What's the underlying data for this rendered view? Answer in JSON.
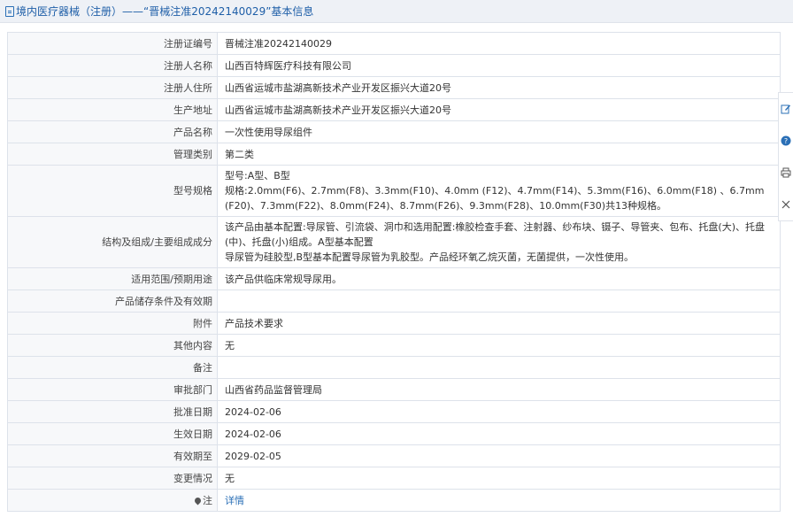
{
  "header": {
    "title": "境内医疗器械（注册）——“晋械注准20242140029”基本信息"
  },
  "rows": [
    {
      "label": "注册证编号",
      "lines": [
        "晋械注准20242140029"
      ]
    },
    {
      "label": "注册人名称",
      "lines": [
        "山西百特辉医疗科技有限公司"
      ]
    },
    {
      "label": "注册人住所",
      "lines": [
        "山西省运城市盐湖高新技术产业开发区振兴大道20号"
      ]
    },
    {
      "label": "生产地址",
      "lines": [
        "山西省运城市盐湖高新技术产业开发区振兴大道20号"
      ]
    },
    {
      "label": "产品名称",
      "lines": [
        "一次性使用导尿组件"
      ]
    },
    {
      "label": "管理类别",
      "lines": [
        "第二类"
      ]
    },
    {
      "label": "型号规格",
      "lines": [
        "型号:A型、B型",
        "规格:2.0mm(F6)、2.7mm(F8)、3.3mm(F10)、4.0mm (F12)、4.7mm(F14)、5.3mm(F16)、6.0mm(F18) 、6.7mm(F20)、7.3mm(F22)、8.0mm(F24)、8.7mm(F26)、9.3mm(F28)、10.0mm(F30)共13种规格。"
      ]
    },
    {
      "label": "结构及组成/主要组成成分",
      "lines": [
        "该产品由基本配置:导尿管、引流袋、洞巾和选用配置:橡胶检查手套、注射器、纱布块、镊子、导管夹、包布、托盘(大)、托盘(中)、托盘(小)组成。A型基本配置",
        "导尿管为硅胶型,B型基本配置导尿管为乳胶型。产品经环氧乙烷灭菌，无菌提供，一次性使用。"
      ]
    },
    {
      "label": "适用范围/预期用途",
      "lines": [
        "该产品供临床常规导尿用。"
      ]
    },
    {
      "label": "产品储存条件及有效期",
      "lines": [
        ""
      ]
    },
    {
      "label": "附件",
      "lines": [
        "产品技术要求"
      ]
    },
    {
      "label": "其他内容",
      "lines": [
        "无"
      ]
    },
    {
      "label": "备注",
      "lines": [
        ""
      ]
    },
    {
      "label": "审批部门",
      "lines": [
        "山西省药品监督管理局"
      ]
    },
    {
      "label": "批准日期",
      "lines": [
        "2024-02-06"
      ]
    },
    {
      "label": "生效日期",
      "lines": [
        "2024-02-06"
      ]
    },
    {
      "label": "有效期至",
      "lines": [
        "2029-02-05"
      ]
    },
    {
      "label": "变更情况",
      "lines": [
        "无"
      ]
    }
  ],
  "note_row": {
    "label": "注",
    "link": "详情"
  },
  "side_toolbar": {
    "icons": [
      "edit-icon",
      "help-icon",
      "print-icon",
      "close-icon"
    ]
  },
  "colors": {
    "accent": "#2a6fb6",
    "header_bg": "#eef1f6",
    "border": "#dde2ea"
  }
}
